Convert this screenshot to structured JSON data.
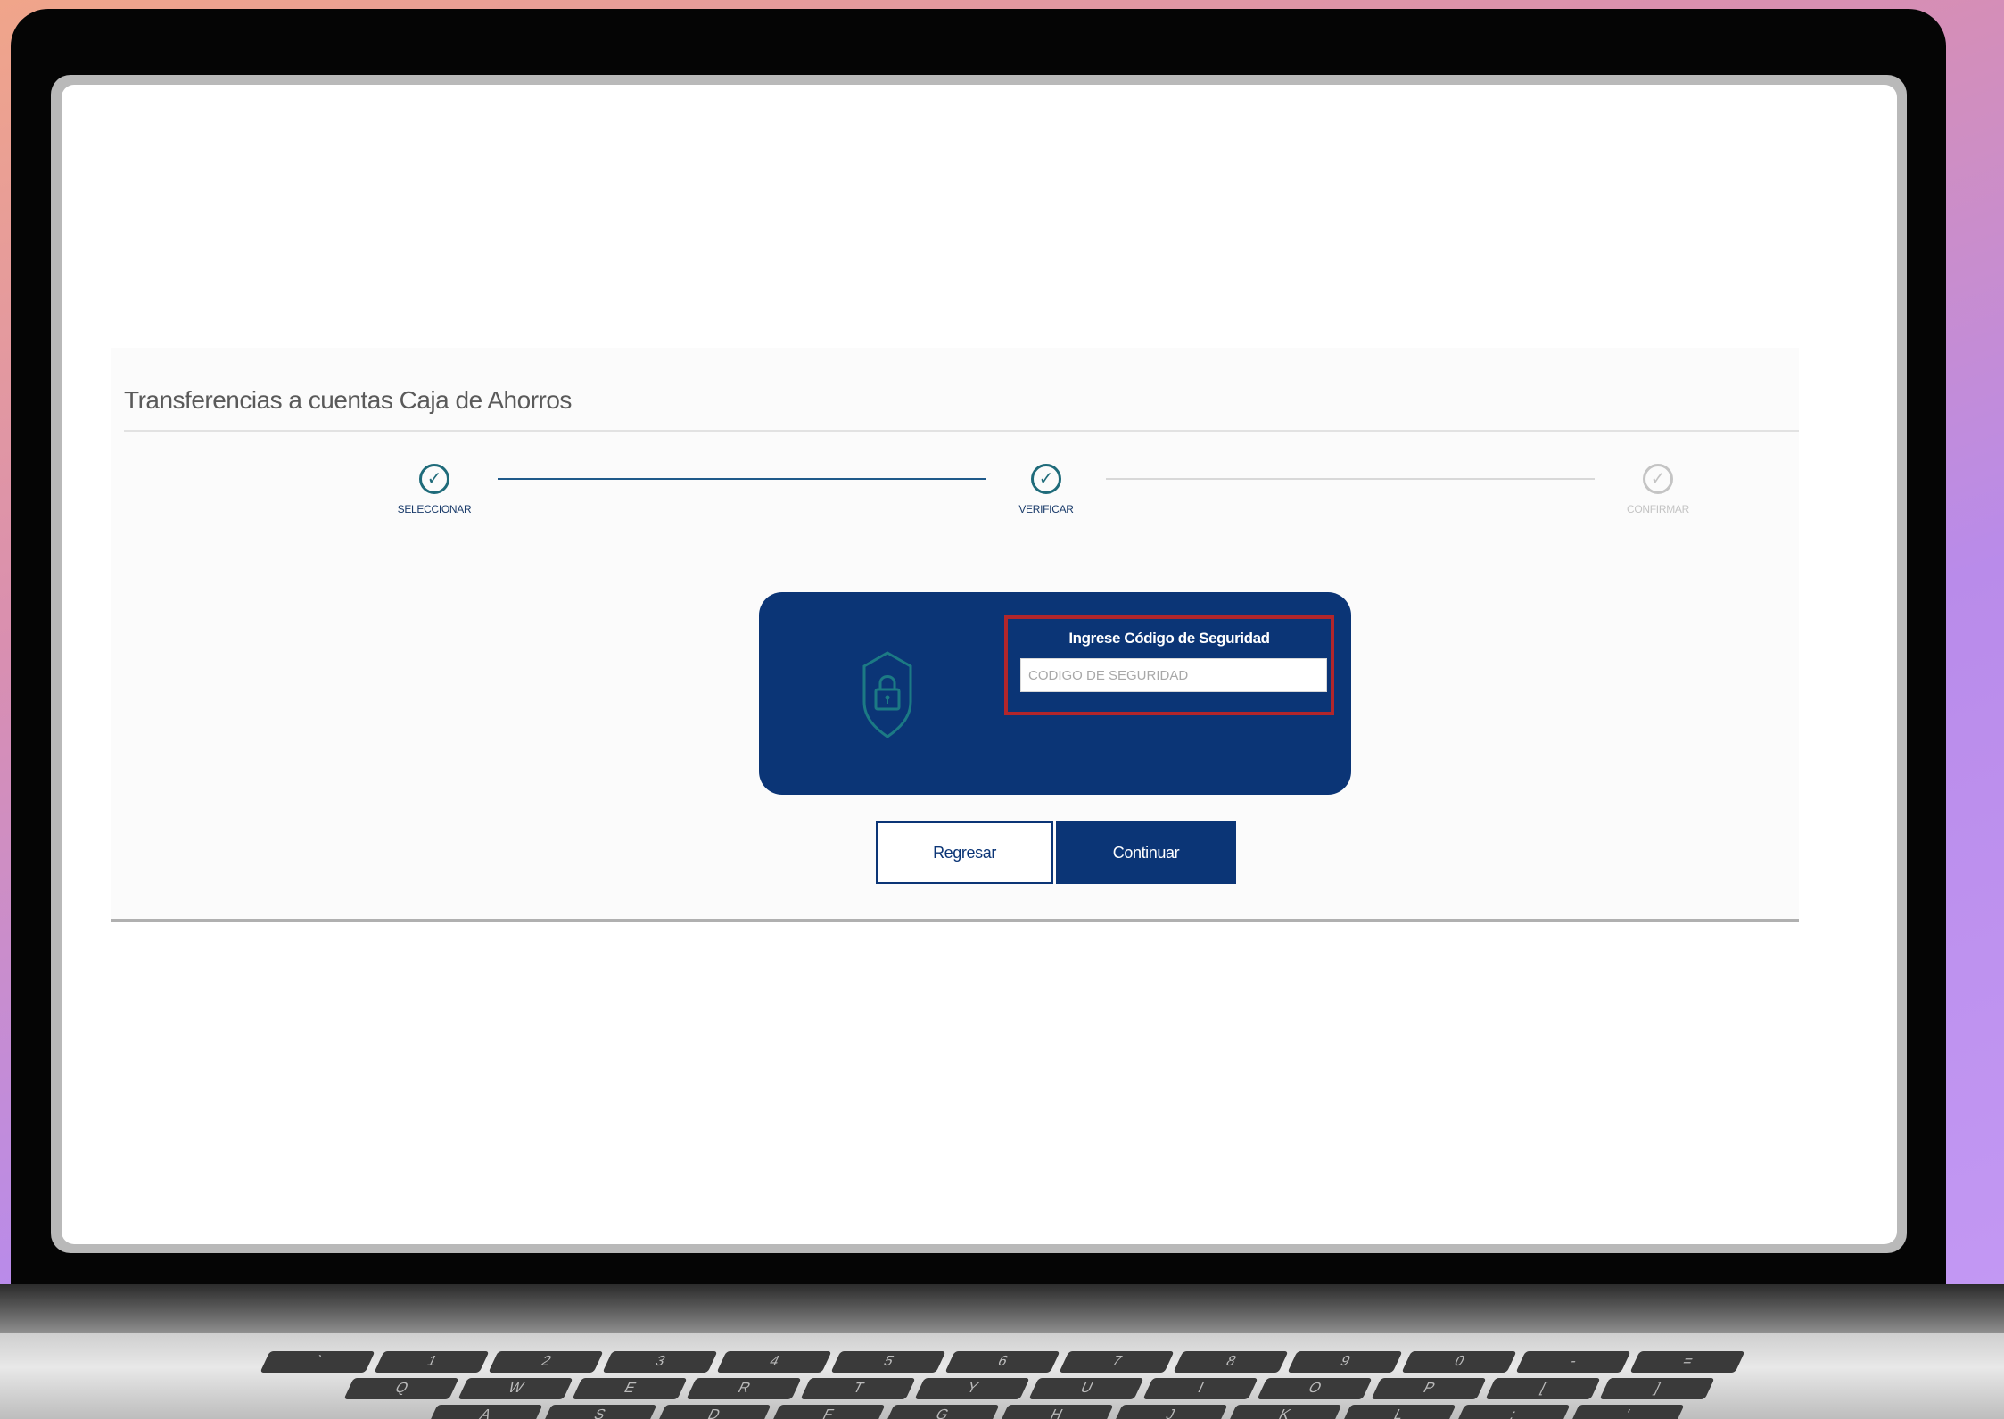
{
  "page": {
    "title": "Transferencias a cuentas Caja de Ahorros"
  },
  "stepper": {
    "steps": [
      {
        "label": "SELECCIONAR",
        "state": "completed"
      },
      {
        "label": "VERIFICAR",
        "state": "completed"
      },
      {
        "label": "CONFIRMAR",
        "state": "pending"
      }
    ]
  },
  "security": {
    "label": "Ingrese Código de Seguridad",
    "placeholder": "CODIGO DE SEGURIDAD",
    "value": ""
  },
  "actions": {
    "back_label": "Regresar",
    "continue_label": "Continuar"
  },
  "keyboard": {
    "row1": [
      "`",
      "1",
      "2",
      "3",
      "4",
      "5",
      "6",
      "7",
      "8",
      "9",
      "0",
      "-",
      "="
    ],
    "row2": [
      "Q",
      "W",
      "E",
      "R",
      "T",
      "Y",
      "U",
      "I",
      "O",
      "P",
      "[",
      "]"
    ],
    "row3": [
      "A",
      "S",
      "D",
      "F",
      "G",
      "H",
      "J",
      "K",
      "L",
      ";",
      "'"
    ]
  },
  "colors": {
    "primary": "#0b3576",
    "accent": "#1f6b7a",
    "highlight_border": "#b2262b",
    "inactive": "#c4c4c4"
  },
  "icons": {
    "check": "check-circle-icon",
    "shield": "shield-lock-icon"
  }
}
